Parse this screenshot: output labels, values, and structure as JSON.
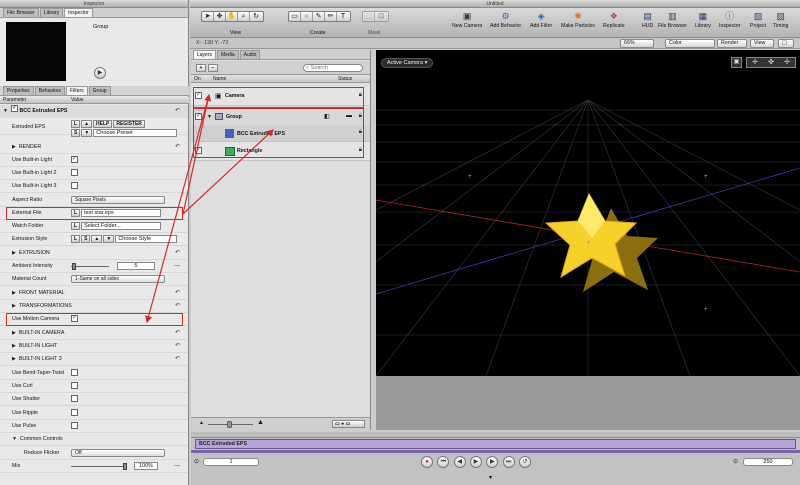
{
  "inspector": {
    "window_title": "Inspector",
    "top_tabs": [
      "File Browser",
      "Library",
      "Inspector"
    ],
    "preview_label": "Group",
    "sub_tabs": [
      "Properties",
      "Behaviors",
      "Filters",
      "Group"
    ],
    "col_param": "Parameter",
    "col_value": "Value",
    "filter_name": "BCC Extruded EPS",
    "rows": {
      "extruded_eps": {
        "label": "Extruded EPS",
        "help": "HELP",
        "register": "REGISTER",
        "preset": "Choose Preset"
      },
      "render": {
        "label": "RENDER"
      },
      "light1": {
        "label": "Use Built-in Light"
      },
      "light2": {
        "label": "Use Built-in Light 2"
      },
      "light3": {
        "label": "Use Built-in Light 3"
      },
      "aspect": {
        "label": "Aspect Ratio",
        "value": "Square Pixels"
      },
      "external_file": {
        "label": "External File",
        "value": "test star.eps"
      },
      "watch_folder": {
        "label": "Watch Folder",
        "value": "Select Folder..."
      },
      "extrusion_style": {
        "label": "Extrusion Style",
        "value": "Choose Style"
      },
      "extrusion": {
        "label": "EXTRUSION"
      },
      "ambient": {
        "label": "Ambient Intensity",
        "value": "5"
      },
      "material_count": {
        "label": "Material Count",
        "value": "1-Same on all sides"
      },
      "front_material": {
        "label": "FRONT MATERIAL"
      },
      "transformations": {
        "label": "TRANSFORMATIONS"
      },
      "motion_camera": {
        "label": "Use Motion Camera"
      },
      "builtin_camera": {
        "label": "BUILT-IN CAMERA"
      },
      "builtin_light1": {
        "label": "BUILT-IN LIGHT"
      },
      "builtin_light3": {
        "label": "BUILT-IN LIGHT 3"
      },
      "bend": {
        "label": "Use Bend-Taper-Twist"
      },
      "curl": {
        "label": "Use Curl"
      },
      "shatter": {
        "label": "Use Shatter"
      },
      "ripple": {
        "label": "Use Ripple"
      },
      "pulse": {
        "label": "Use Pulse"
      },
      "common": {
        "label": "Common Controls"
      },
      "flicker": {
        "label": "Reduce Flicker",
        "value": "Off"
      },
      "mix": {
        "label": "Mix",
        "value": "100%"
      }
    }
  },
  "main": {
    "window_title": "Untitled",
    "toolbar": {
      "view": "View",
      "create": "Create",
      "mask": "Mask",
      "new_camera": "New Camera",
      "add_behavior": "Add Behavior",
      "add_filter": "Add Filter",
      "make_particles": "Make Particles",
      "replicate": "Replicate",
      "hud": "HUD",
      "file_browser": "File Browser",
      "library": "Library",
      "inspector": "Inspector",
      "project": "Project",
      "timing": "Timing"
    },
    "coords": "X: -130   Y: -73",
    "zoom": "66%",
    "color": "Color",
    "render": "Render",
    "view": "View",
    "layer_tabs": [
      "Layers",
      "Media",
      "Audio"
    ],
    "search_placeholder": "Search",
    "col_on": "On",
    "col_name": "Name",
    "col_status": "Status",
    "layers": {
      "camera": "Camera",
      "group": "Group",
      "bcc": "BCC Extruded EPS",
      "rectangle": "Rectangle"
    },
    "canvas_camera": "Active Camera",
    "timeline_clip": "BCC Extruded EPS",
    "current_frame": "1",
    "end_frame": "250"
  },
  "colors": {
    "highlight": "#d42a2a",
    "star": "#f5d12a",
    "clip": "#b9a3d6"
  }
}
